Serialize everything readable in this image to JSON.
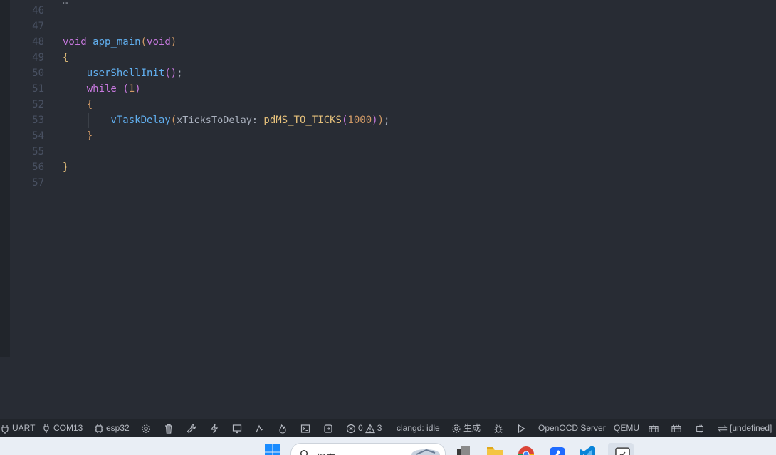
{
  "editor": {
    "lines": [
      {
        "number": "46"
      },
      {
        "number": "47"
      },
      {
        "number": "48",
        "kw": "void",
        "fn": "app_main",
        "p_open": "(",
        "param": "void",
        "p_close": ")"
      },
      {
        "number": "49",
        "text": "{"
      },
      {
        "number": "50",
        "fn": "userShellInit",
        "p_open": "(",
        "p_close": ")",
        "semi": ";"
      },
      {
        "number": "51",
        "kw": "while",
        "p_open": "(",
        "num": "1",
        "p_close": ")"
      },
      {
        "number": "52",
        "text": "{"
      },
      {
        "number": "53",
        "fn": "vTaskDelay",
        "p_open": "(",
        "hint": "xTicksToDelay:",
        "macro": "pdMS_TO_TICKS",
        "m_open": "(",
        "num": "1000",
        "m_close": ")",
        "p_close": ")",
        "semi": ";"
      },
      {
        "number": "54",
        "text": "}"
      },
      {
        "number": "55"
      },
      {
        "number": "56",
        "text": "}"
      },
      {
        "number": "57"
      }
    ]
  },
  "statusbar": {
    "items": [
      {
        "icon": "plug-icon",
        "label": "UART"
      },
      {
        "icon": "plug-icon",
        "label": "COM13"
      },
      {
        "icon": "chip-icon",
        "label": "esp32"
      },
      {
        "icon": "gear-icon",
        "label": ""
      },
      {
        "icon": "trash-icon",
        "label": ""
      },
      {
        "icon": "wrench-icon",
        "label": ""
      },
      {
        "icon": "lightning-icon",
        "label": ""
      },
      {
        "icon": "monitor-icon",
        "label": ""
      },
      {
        "icon": "flash-monitor-icon",
        "label": ""
      },
      {
        "icon": "flame-icon",
        "label": ""
      },
      {
        "icon": "terminal-icon",
        "label": ""
      },
      {
        "icon": "extension-icon",
        "label": ""
      }
    ],
    "errors": "0",
    "warnings": "3",
    "clangd": "clangd: idle",
    "build_label": "生成",
    "openocd": "OpenOCD Server",
    "qemu": "QEMU",
    "undefined": "[undefined]"
  },
  "taskbar": {
    "search_placeholder": "搜索"
  }
}
